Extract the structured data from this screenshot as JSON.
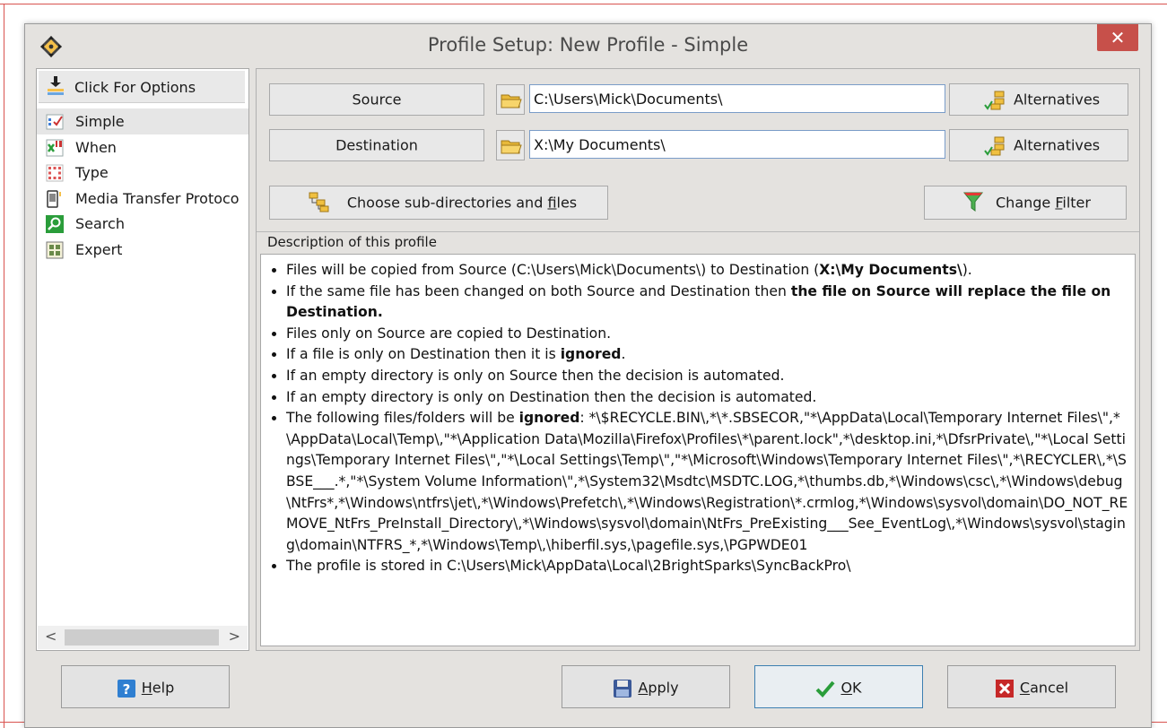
{
  "window": {
    "title": "Profile Setup: New Profile - Simple",
    "close_label": "✕"
  },
  "sidebar": {
    "header_label": "Click For Options",
    "items": [
      {
        "label": "Simple",
        "icon": "simple-icon",
        "selected": true
      },
      {
        "label": "When",
        "icon": "when-icon"
      },
      {
        "label": "Type",
        "icon": "type-icon"
      },
      {
        "label": "Media Transfer Protoco",
        "icon": "mtp-icon"
      },
      {
        "label": "Search",
        "icon": "search-icon"
      },
      {
        "label": "Expert",
        "icon": "expert-icon"
      }
    ],
    "scroll_left": "<",
    "scroll_right": ">"
  },
  "source": {
    "button_label": "Source",
    "path_value": "C:\\Users\\Mick\\Documents\\",
    "alternatives_label": "Alternatives"
  },
  "destination": {
    "button_label": "Destination",
    "path_value": "X:\\My Documents\\",
    "alternatives_label": "Alternatives"
  },
  "subdirs": {
    "prefix": "Choose sub-directories and ",
    "underlined": "f",
    "suffix": "iles"
  },
  "filter": {
    "prefix": "Change ",
    "underlined": "F",
    "suffix": "ilter"
  },
  "description": {
    "label": "Description of this profile",
    "items": [
      {
        "pre": "Files will be copied from Source (C:\\Users\\Mick\\Documents\\) to Destination (",
        "bold": "X:\\My Documents\\",
        "post": ")."
      },
      {
        "pre": "If the same file has been changed on both Source and Destination then ",
        "bold": "the file on Source will replace the file on Destination.",
        "post": ""
      },
      {
        "pre": "Files only on Source are copied to Destination.",
        "bold": "",
        "post": ""
      },
      {
        "pre": "If a file is only on Destination then it is ",
        "bold": "ignored",
        "post": "."
      },
      {
        "pre": "If an empty directory is only on Source then the decision is automated.",
        "bold": "",
        "post": ""
      },
      {
        "pre": "If an empty directory is only on Destination then the decision is automated.",
        "bold": "",
        "post": ""
      },
      {
        "pre": "The following files/folders will be ",
        "bold": "ignored",
        "post": ": *\\$RECYCLE.BIN\\,*\\*.SBSECOR,\"*\\AppData\\Local\\Temporary Internet Files\\\",*\\AppData\\Local\\Temp\\,\"*\\Application Data\\Mozilla\\Firefox\\Profiles\\*\\parent.lock\",*\\desktop.ini,*\\DfsrPrivate\\,\"*\\Local Settings\\Temporary Internet Files\\\",\"*\\Local Settings\\Temp\\\",\"*\\Microsoft\\Windows\\Temporary Internet Files\\\",*\\RECYCLER\\,*\\SBSE___.*,\"*\\System Volume Information\\\",*\\System32\\Msdtc\\MSDTC.LOG,*\\thumbs.db,*\\Windows\\csc\\,*\\Windows\\debug\\NtFrs*,*\\Windows\\ntfrs\\jet\\,*\\Windows\\Prefetch\\,*\\Windows\\Registration\\*.crmlog,*\\Windows\\sysvol\\domain\\DO_NOT_REMOVE_NtFrs_PreInstall_Directory\\,*\\Windows\\sysvol\\domain\\NtFrs_PreExisting___See_EventLog\\,*\\Windows\\sysvol\\staging\\domain\\NTFRS_*,*\\Windows\\Temp\\,\\hiberfil.sys,\\pagefile.sys,\\PGPWDE01"
      },
      {
        "pre": "The profile is stored in C:\\Users\\Mick\\AppData\\Local\\2BrightSparks\\SyncBackPro\\",
        "bold": "",
        "post": ""
      }
    ]
  },
  "footer": {
    "help": {
      "underlined": "H",
      "rest": "elp"
    },
    "apply": {
      "underlined": "A",
      "rest": "pply"
    },
    "ok": {
      "underlined": "O",
      "rest": "K"
    },
    "cancel": {
      "underlined": "C",
      "rest": "ancel"
    }
  },
  "colors": {
    "window_bg": "#e4e2df",
    "close_red": "#c7504a",
    "input_border": "#7a9cc8",
    "ok_border": "#3c7fb1"
  }
}
